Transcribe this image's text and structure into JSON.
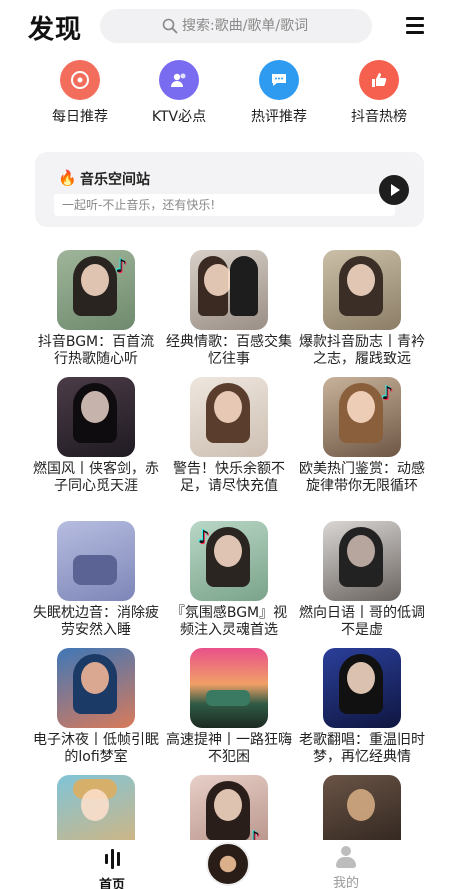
{
  "header": {
    "title": "发现",
    "search_placeholder": "搜索:歌曲/歌单/歌词"
  },
  "quick_entries": [
    {
      "label": "每日推荐",
      "icon": "disc-icon",
      "color": "#f26d5b"
    },
    {
      "label": "KTV必点",
      "icon": "group-icon",
      "color": "#7a6cf0"
    },
    {
      "label": "热评推荐",
      "icon": "chat-icon",
      "color": "#2f9bf0"
    },
    {
      "label": "抖音热榜",
      "icon": "thumbs-up-icon",
      "color": "#f5604f"
    }
  ],
  "banner": {
    "title": "音乐空间站",
    "subtitle": "一起听-不止音乐，还有快乐!",
    "icon": "fire-icon",
    "action_icon": "play-icon"
  },
  "playlists": [
    {
      "title": "抖音BGM：百首流行热歌随心听"
    },
    {
      "title": "经典情歌：百感交集忆往事"
    },
    {
      "title": "爆款抖音励志丨青衿之志，履践致远"
    },
    {
      "title": "燃国风丨侠客剑，赤子同心觅天涯"
    },
    {
      "title": "警告！快乐余额不足，请尽快充值"
    },
    {
      "title": "欧美热门鉴赏：动感旋律带你无限循环"
    },
    {
      "title": "失眠枕边音：消除疲劳安然入睡"
    },
    {
      "title": "『氛围感BGM』视频注入灵魂首选"
    },
    {
      "title": "燃向日语丨哥的低调不是虚"
    },
    {
      "title": "电子沐夜丨低帧引眠的lofi梦室"
    },
    {
      "title": "高速提神丨一路狂嗨不犯困"
    },
    {
      "title": "老歌翻唱：重温旧时梦，再忆经典情"
    },
    {
      "title": ""
    },
    {
      "title": ""
    },
    {
      "title": ""
    }
  ],
  "bottom_nav": {
    "home_label": "首页",
    "mine_label": "我的"
  }
}
